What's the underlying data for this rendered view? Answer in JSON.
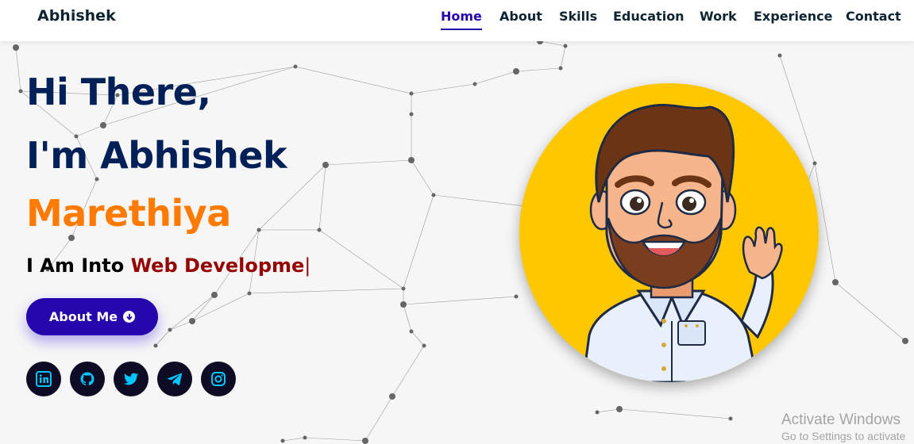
{
  "header": {
    "logo": "Abhishek",
    "nav": [
      {
        "label": "Home",
        "active": true
      },
      {
        "label": "About",
        "active": false
      },
      {
        "label": "Skills",
        "active": false
      },
      {
        "label": "Education",
        "active": false
      },
      {
        "label": "Work",
        "active": false
      },
      {
        "label": "Experience",
        "active": false
      },
      {
        "label": "Contact",
        "active": false
      }
    ]
  },
  "hero": {
    "greeting": "Hi There,",
    "intro": "I'm Abhishek",
    "surname": "Marethiya",
    "typing_prefix": "I Am Into ",
    "typing_text": "Web Developme",
    "typing_cursor": "|",
    "about_button": "About Me"
  },
  "socials": [
    {
      "name": "linkedin-icon"
    },
    {
      "name": "github-icon"
    },
    {
      "name": "twitter-icon"
    },
    {
      "name": "telegram-icon"
    },
    {
      "name": "instagram-icon"
    }
  ],
  "watermark": {
    "line1": "Activate Windows",
    "line2": "Go to Settings to activate"
  },
  "colors": {
    "primary": "#2506ad",
    "heading": "#002057",
    "accent": "#ff7a00",
    "typed": "#960000",
    "avatar_bg": "#ffc700",
    "social_bg": "#0e0c24"
  }
}
